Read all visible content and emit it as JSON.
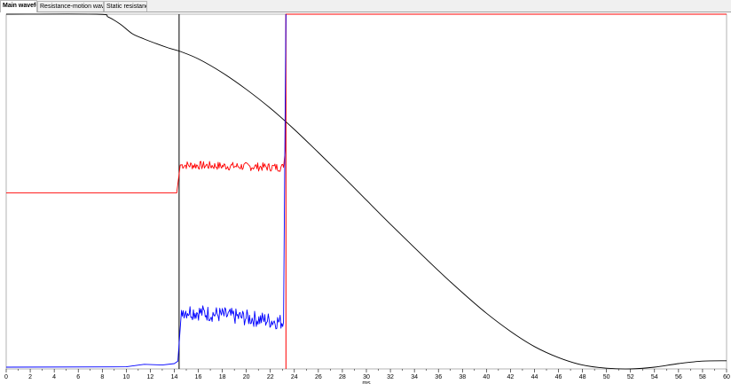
{
  "tabs": [
    {
      "label": "Main waveform",
      "active": true
    },
    {
      "label": "Resistance-motion waveform",
      "active": false
    },
    {
      "label": "Static resistance",
      "active": false
    }
  ],
  "chart_data": {
    "type": "line",
    "xlabel": "ms",
    "ylabel": "",
    "xlim": [
      0,
      60
    ],
    "x_ticks": [
      0,
      2,
      4,
      6,
      8,
      10,
      12,
      14,
      16,
      18,
      20,
      22,
      24,
      26,
      28,
      30,
      32,
      34,
      36,
      38,
      40,
      42,
      44,
      46,
      48,
      50,
      52,
      54,
      56,
      58,
      60
    ],
    "ylim": [
      0,
      100
    ],
    "grid": false,
    "markers": [
      {
        "x": 14.4,
        "color": "#000000"
      },
      {
        "x": 23.3,
        "color": "#ff0000"
      }
    ],
    "series": [
      {
        "color": "#000000",
        "x": [
          0,
          7.5,
          8.5,
          9.5,
          10.5,
          11.5,
          12.5,
          13.5,
          14.5,
          16,
          18,
          20,
          22,
          24,
          26,
          28,
          30,
          32,
          34,
          36,
          38,
          40,
          42,
          44,
          46,
          48,
          50,
          52,
          54,
          56,
          58,
          60
        ],
        "y": [
          100,
          100,
          99.2,
          97.2,
          94.5,
          93,
          91.7,
          90.5,
          89.5,
          87.4,
          83.5,
          78.8,
          73.5,
          67.5,
          61,
          54.4,
          47.6,
          40.8,
          34.2,
          27.7,
          21.5,
          15.7,
          10.6,
          6.3,
          3.2,
          1.1,
          0.2,
          0,
          0.5,
          1.5,
          2.2,
          2.3
        ]
      },
      {
        "color": "#ff0000",
        "x": [
          0,
          14.2,
          14.5,
          23.1,
          23.25,
          23.3,
          60
        ],
        "y": [
          49.6,
          49.6,
          57.5,
          56.8,
          62,
          100,
          100
        ],
        "noise": [
          14.5,
          23.1,
          1.2
        ]
      },
      {
        "color": "#0000ff",
        "x": [
          0,
          10,
          11.5,
          13,
          14,
          14.3,
          14.6,
          23.1,
          23.3
        ],
        "y": [
          0.5,
          0.6,
          1.3,
          1.1,
          1.5,
          2.2,
          16.5,
          13.2,
          100
        ],
        "noise": [
          14.6,
          23.1,
          2.3
        ]
      }
    ]
  }
}
